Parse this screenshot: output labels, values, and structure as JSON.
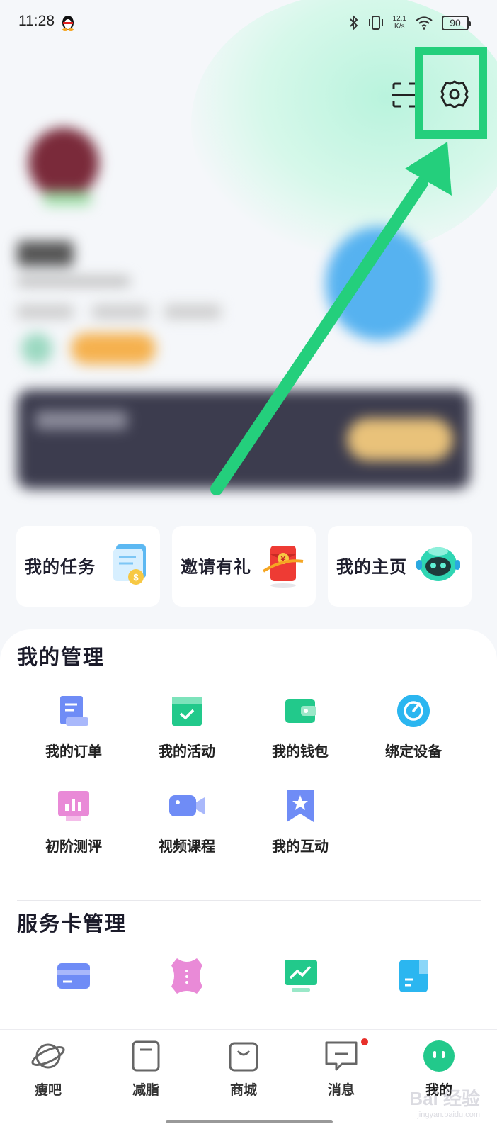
{
  "status_bar": {
    "time": "11:28",
    "net_speed_value": "12.1",
    "net_speed_unit": "K/s",
    "battery": "90"
  },
  "header": {
    "scan_icon": "scan-icon",
    "settings_icon": "gear-icon"
  },
  "quick_links": [
    {
      "label": "我的任务",
      "icon": "task-notebook-icon"
    },
    {
      "label": "邀请有礼",
      "icon": "red-envelope-icon"
    },
    {
      "label": "我的主页",
      "icon": "robot-avatar-icon"
    }
  ],
  "management": {
    "title": "我的管理",
    "items": [
      {
        "label": "我的订单",
        "icon": "order-icon"
      },
      {
        "label": "我的活动",
        "icon": "calendar-check-icon"
      },
      {
        "label": "我的钱包",
        "icon": "wallet-icon"
      },
      {
        "label": "绑定设备",
        "icon": "device-bind-icon"
      },
      {
        "label": "初阶测评",
        "icon": "assessment-chart-icon"
      },
      {
        "label": "视频课程",
        "icon": "video-camera-icon"
      },
      {
        "label": "我的互动",
        "icon": "star-bookmark-icon"
      }
    ]
  },
  "service_cards": {
    "title": "服务卡管理",
    "items": [
      {
        "icon": "card-icon"
      },
      {
        "icon": "body-shape-icon"
      },
      {
        "icon": "trend-monitor-icon"
      },
      {
        "icon": "notebook-icon"
      }
    ]
  },
  "tabbar": {
    "items": [
      {
        "label": "瘦吧",
        "icon": "planet-icon"
      },
      {
        "label": "减脂",
        "icon": "scale-icon"
      },
      {
        "label": "商城",
        "icon": "shopping-bag-icon"
      },
      {
        "label": "消息",
        "icon": "message-icon"
      },
      {
        "label": "我的",
        "icon": "profile-face-icon"
      }
    ]
  },
  "watermark": {
    "brand": "Bai 经验",
    "url": "jingyan.baidu.com"
  },
  "colors": {
    "accent_green": "#24cf7c",
    "highlight": "#24cf7c"
  }
}
